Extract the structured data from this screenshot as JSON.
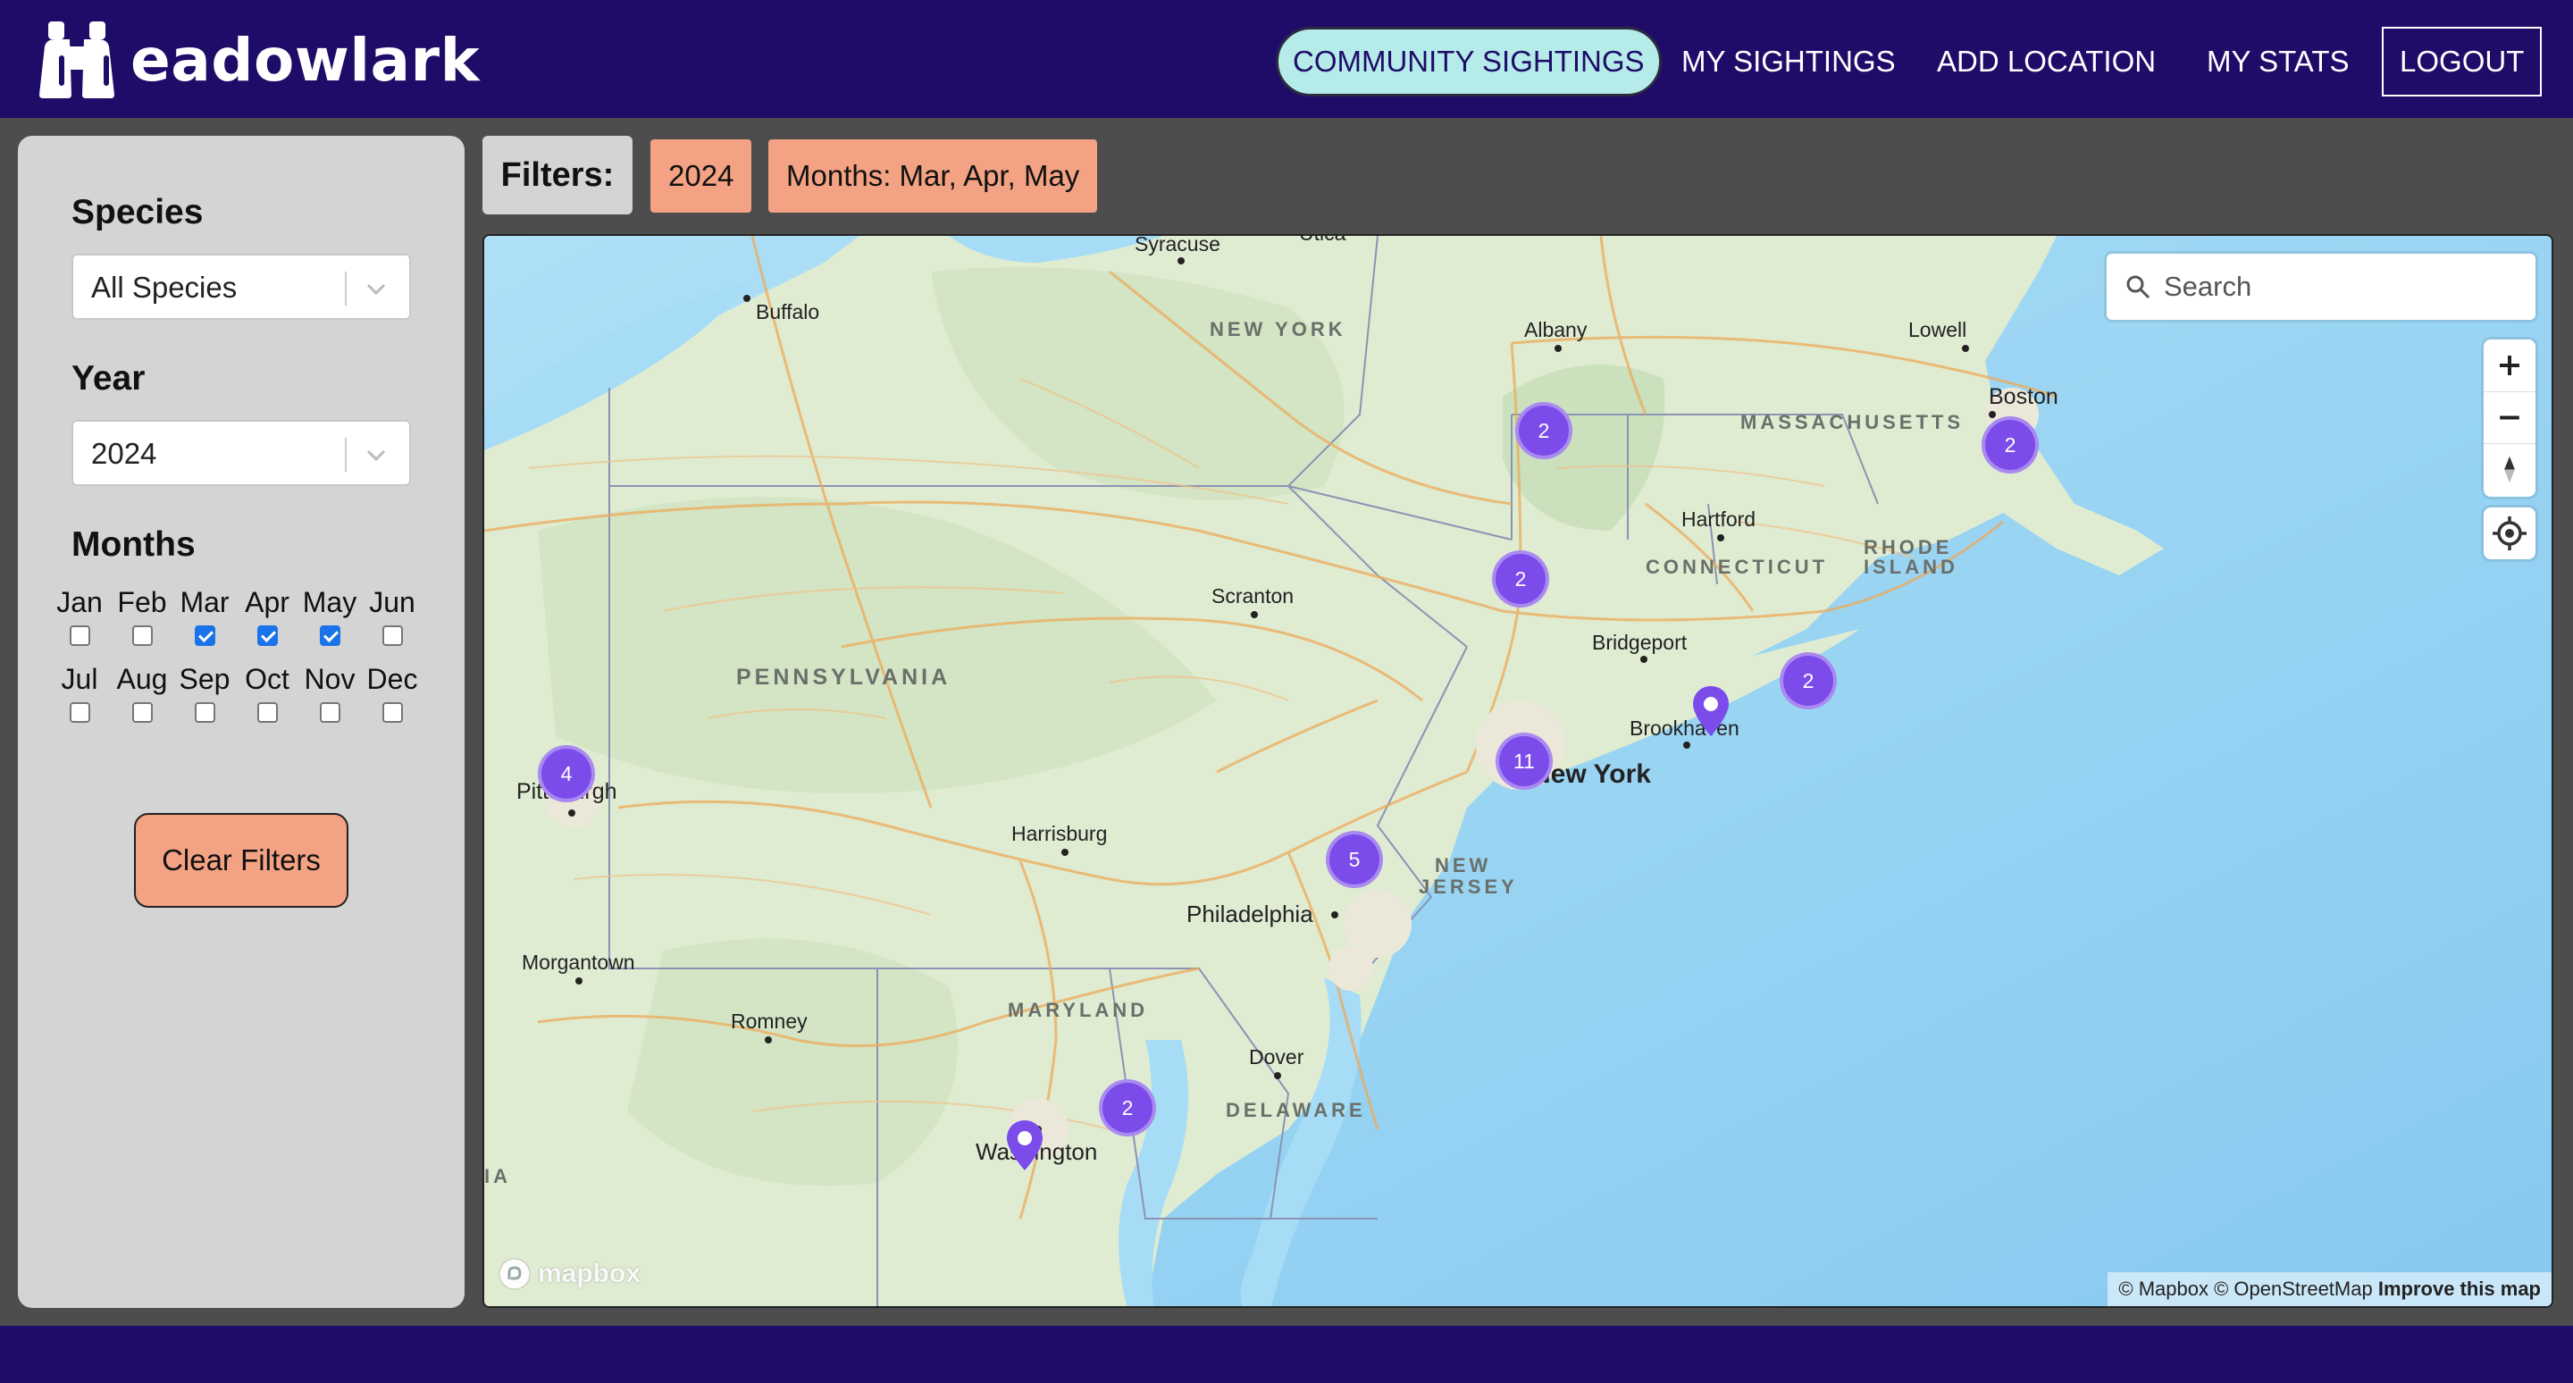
{
  "app": {
    "name": "eadowlark"
  },
  "nav": {
    "community_sightings": "COMMUNITY SIGHTINGS",
    "my_sightings": "MY SIGHTINGS",
    "add_location": "ADD LOCATION",
    "my_stats": "MY STATS",
    "logout": "LOGOUT"
  },
  "sidebar": {
    "species_label": "Species",
    "species_value": "All Species",
    "year_label": "Year",
    "year_value": "2024",
    "months_label": "Months",
    "months": [
      {
        "label": "Jan",
        "checked": false
      },
      {
        "label": "Feb",
        "checked": false
      },
      {
        "label": "Mar",
        "checked": true
      },
      {
        "label": "Apr",
        "checked": true
      },
      {
        "label": "May",
        "checked": true
      },
      {
        "label": "Jun",
        "checked": false
      },
      {
        "label": "Jul",
        "checked": false
      },
      {
        "label": "Aug",
        "checked": false
      },
      {
        "label": "Sep",
        "checked": false
      },
      {
        "label": "Oct",
        "checked": false
      },
      {
        "label": "Nov",
        "checked": false
      },
      {
        "label": "Dec",
        "checked": false
      }
    ],
    "clear_button": "Clear Filters"
  },
  "filters": {
    "label": "Filters:",
    "chips": [
      "2024",
      "Months: Mar, Apr, May"
    ]
  },
  "map": {
    "search_placeholder": "Search",
    "cities": [
      "Syracuse",
      "Utica",
      "Buffalo",
      "Albany",
      "Lowell",
      "Boston",
      "Hartford",
      "Scranton",
      "Bridgeport",
      "Brookhaven",
      "New York",
      "Pittsburgh",
      "Harrisburg",
      "Philadelphia",
      "Morgantown",
      "Romney",
      "Dover",
      "Washington"
    ],
    "states": [
      "NEW YORK",
      "MASSACHUSETTS",
      "CONNECTICUT",
      "RHODE",
      "ISLAND",
      "PENNSYLVANIA",
      "NEW",
      "JERSEY",
      "MARYLAND",
      "DELAWARE",
      "IA"
    ],
    "clusters": [
      "2",
      "2",
      "2",
      "2",
      "11",
      "5",
      "4",
      "2"
    ],
    "logo_text": "mapbox",
    "attribution": "© Mapbox © OpenStreetMap",
    "improve_link": "Improve this map",
    "colors": {
      "cluster": "#7b4ce9",
      "land": "#dfecd2",
      "water": "#a6dcf5",
      "roads": "#eca95a"
    }
  },
  "colors": {
    "header": "#1f0c69",
    "active_tab": "#b5ece9",
    "chip": "#f3a383",
    "panel": "#d4d4d4"
  }
}
